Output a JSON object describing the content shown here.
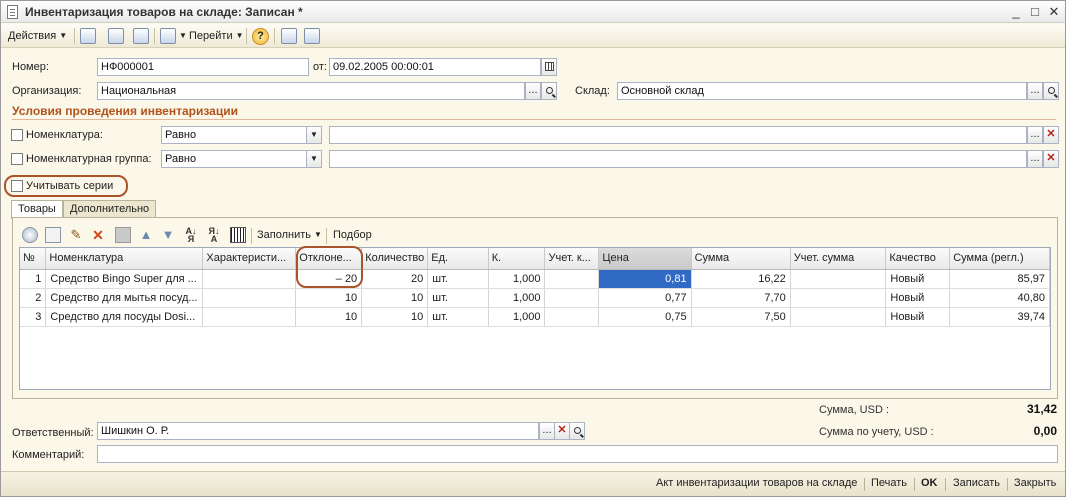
{
  "window": {
    "title": "Инвентаризация товаров на складе: Записан *"
  },
  "window_controls": {
    "minimize": "_",
    "maximize": "□",
    "close": "✕"
  },
  "toolbar": {
    "actions_label": "Действия",
    "goto_label": "Перейти",
    "help_label": "?"
  },
  "header": {
    "number_label": "Номер:",
    "number_value": "НФ000001",
    "date_label": "от:",
    "date_value": "09.02.2005 00:00:01",
    "org_label": "Организация:",
    "org_value": "Национальная",
    "warehouse_label": "Склад:",
    "warehouse_value": "Основной склад"
  },
  "conditions": {
    "title": "Условия проведения инвентаризации",
    "nomenclature_label": "Номенклатура:",
    "nomenclature_op": "Равно",
    "group_label": "Номенклатурная группа:",
    "group_op": "Равно",
    "series_label": "Учитывать серии"
  },
  "tabs": [
    "Товары",
    "Дополнительно"
  ],
  "table_toolbar": {
    "fill_label": "Заполнить",
    "select_label": "Подбор"
  },
  "table": {
    "columns": [
      "№",
      "Номенклатура",
      "Характеристи...",
      "Отклоне...",
      "Количество",
      "Ед.",
      "К.",
      "Учет. к...",
      "Цена",
      "Сумма",
      "Учет. сумма",
      "Качество",
      "Сумма (регл.)"
    ],
    "rows": [
      [
        "1",
        "Средство Bingo Super для ...",
        "",
        "– 20",
        "20",
        "шт.",
        "1,000",
        "",
        "0,81",
        "16,22",
        "",
        "Новый",
        "85,97"
      ],
      [
        "2",
        "Средство для мытья посуд...",
        "",
        "10",
        "10",
        "шт.",
        "1,000",
        "",
        "0,77",
        "7,70",
        "",
        "Новый",
        "40,80"
      ],
      [
        "3",
        "Средство для посуды Dosi...",
        "",
        "10",
        "10",
        "шт.",
        "1,000",
        "",
        "0,75",
        "7,50",
        "",
        "Новый",
        "39,74"
      ]
    ]
  },
  "totals": {
    "sum_label": "Сумма, USD :",
    "sum_value": "31,42",
    "acc_sum_label": "Сумма по учету, USD :",
    "acc_sum_value": "0,00"
  },
  "footer": {
    "responsible_label": "Ответственный:",
    "responsible_value": "Шишкин О. Р.",
    "comment_label": "Комментарий:",
    "comment_value": ""
  },
  "bottombar": {
    "report_label": "Акт инвентаризации товаров на складе",
    "print_label": "Печать",
    "ok_label": "OK",
    "save_label": "Записать",
    "close_label": "Закрыть"
  },
  "colors": {
    "background": "#fbf7e9",
    "section_title": "#b0541c",
    "selection": "#316ac5",
    "highlight_oval": "#a9542a"
  }
}
